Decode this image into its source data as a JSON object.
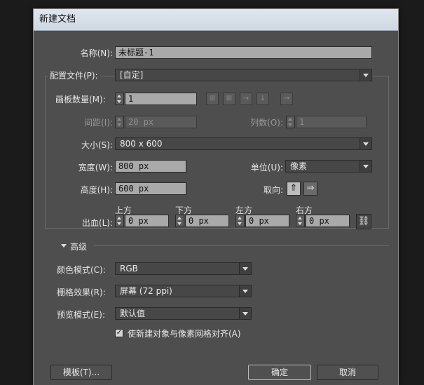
{
  "window": {
    "title": "新建文档"
  },
  "name": {
    "label": "名称(N):",
    "value": "未标题-1"
  },
  "profile": {
    "label": "配置文件(P):",
    "value": "[自定]"
  },
  "artboards": {
    "count_label": "画板数量(M):",
    "count_value": "1",
    "spacing_label": "间距(I):",
    "spacing_value": "20 px",
    "columns_label": "列数(O):",
    "columns_value": "1"
  },
  "size": {
    "label": "大小(S):",
    "value": "800 x 600"
  },
  "width": {
    "label": "宽度(W):",
    "value": "800 px"
  },
  "units": {
    "label": "单位(U):",
    "value": "像素"
  },
  "height": {
    "label": "高度(H):",
    "value": "600 px"
  },
  "orientation": {
    "label": "取向:"
  },
  "bleed": {
    "label": "出血(L):",
    "top_label": "上方",
    "top_value": "0 px",
    "bottom_label": "下方",
    "bottom_value": "0 px",
    "left_label": "左方",
    "left_value": "0 px",
    "right_label": "右方",
    "right_value": "0 px"
  },
  "advanced": {
    "label": "高级"
  },
  "color_mode": {
    "label": "颜色模式(C):",
    "value": "RGB"
  },
  "raster": {
    "label": "栅格效果(R):",
    "value": "屏幕 (72 ppi)"
  },
  "preview": {
    "label": "预览模式(E):",
    "value": "默认值"
  },
  "align": {
    "label": "使新建对象与像素网格对齐(A)",
    "checked": true,
    "check_glyph": "✓"
  },
  "buttons": {
    "templates": "模板(T)...",
    "ok": "确定",
    "cancel": "取消"
  }
}
